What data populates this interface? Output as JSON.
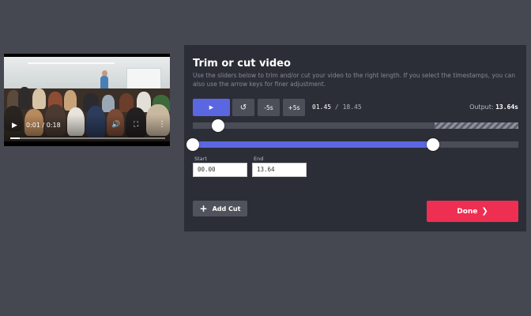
{
  "video": {
    "time_display": "0:01 / 0:18",
    "progress": 0.06
  },
  "panel": {
    "title": "Trim or cut video",
    "description": "Use the sliders below to trim and/or cut your video to the right length. If you select the timestamps, you can also use the arrow keys for finer adjustment.",
    "buttons": {
      "play_icon": "play-icon",
      "reset_icon": "reset-icon",
      "back5_label": "-5s",
      "fwd5_label": "+5s"
    },
    "current_time": "01.45",
    "time_separator": "/",
    "duration": "18.45",
    "output_label": "Output:",
    "output_value": "13.64s",
    "start_label": "Start",
    "start_value": "00.00",
    "end_label": "End",
    "end_value": "13.64",
    "add_cut_label": "Add Cut",
    "done_label": "Done"
  },
  "colors": {
    "accent": "#5b67e0",
    "done": "#ee2f52",
    "panel": "#2c2e37",
    "background": "#454851"
  }
}
